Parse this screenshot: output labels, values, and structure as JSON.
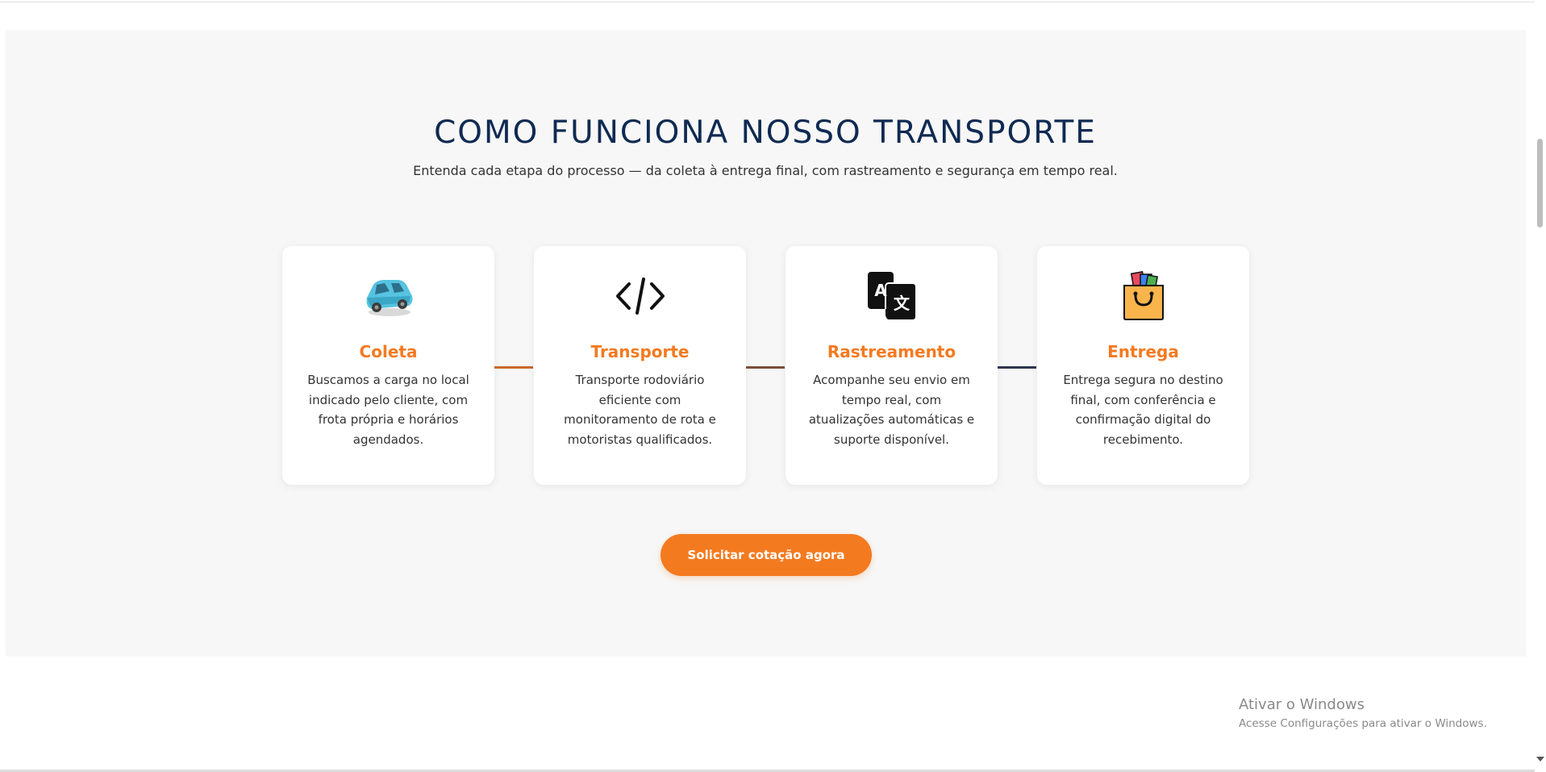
{
  "section": {
    "title": "COMO FUNCIONA NOSSO TRANSPORTE",
    "subtitle": "Entenda cada etapa do processo — da coleta à entrega final, com rastreamento e segurança em tempo real."
  },
  "steps": [
    {
      "icon": "car-icon",
      "title": "Coleta",
      "text": "Buscamos a carga no local indicado pelo cliente, com frota própria e horários agendados."
    },
    {
      "icon": "code-icon",
      "title": "Transporte",
      "text": "Transporte rodoviário eficiente com monitoramento de rota e motoristas qualificados."
    },
    {
      "icon": "translate-icon",
      "title": "Rastreamento",
      "text": "Acompanhe seu envio em tempo real, com atualizações automáticas e suporte disponível."
    },
    {
      "icon": "shopping-bag-icon",
      "title": "Entrega",
      "text": "Entrega segura no destino final, com conferência e confirmação digital do recebimento."
    }
  ],
  "connector_colors": [
    "#c8692a",
    "#7a4f3a",
    "#2e3550"
  ],
  "colors": {
    "accent": "#f47a20",
    "title": "#0f2a52",
    "section_bg": "#f7f7f7"
  },
  "cta": {
    "label": "Solicitar cotação agora"
  },
  "watermark": {
    "title": "Ativar o Windows",
    "subtitle": "Acesse Configurações para ativar o Windows."
  }
}
